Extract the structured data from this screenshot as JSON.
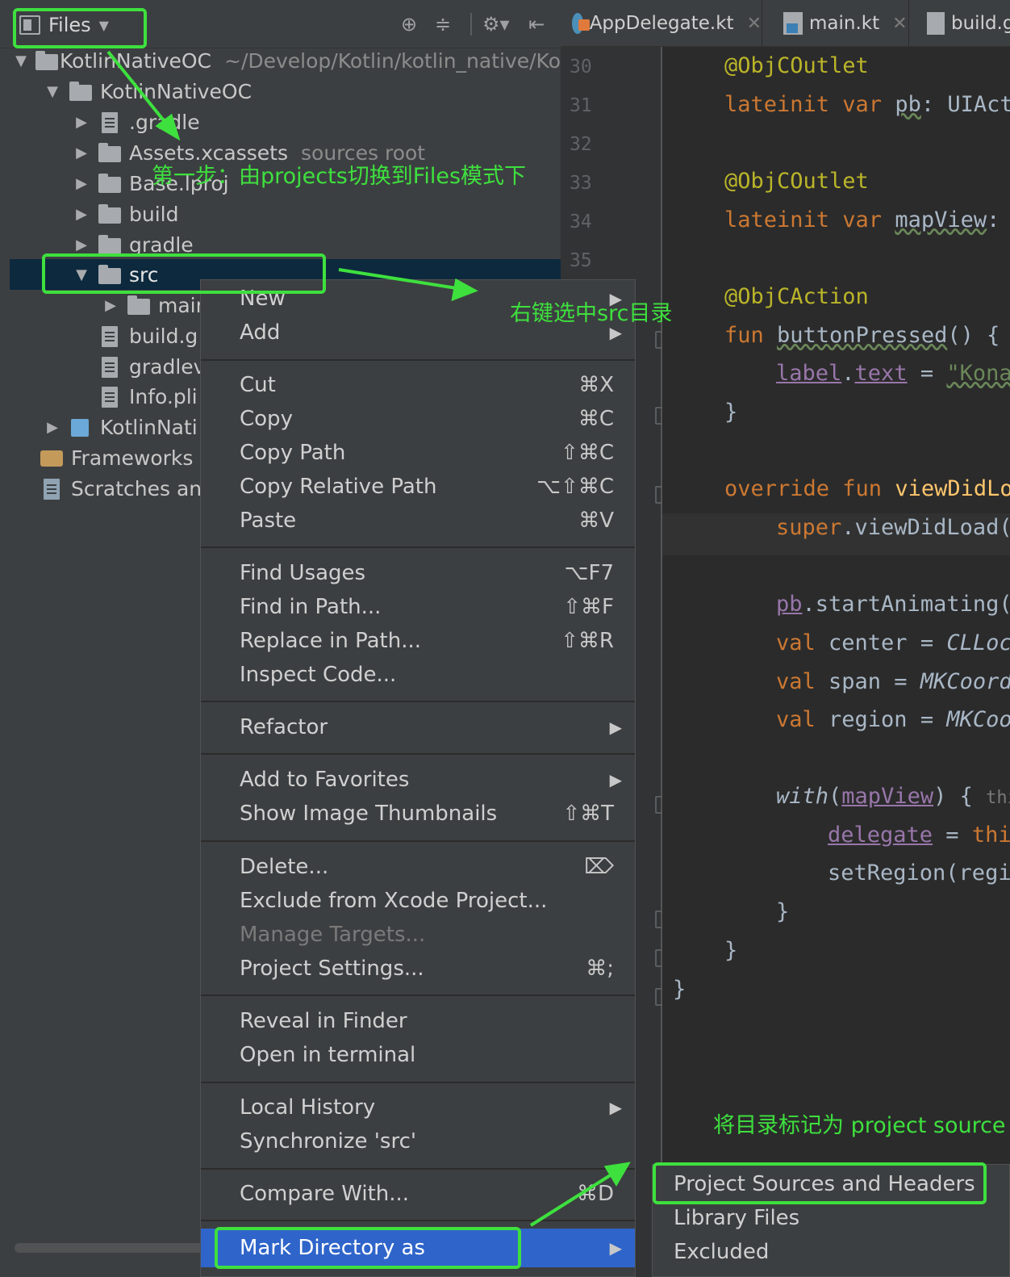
{
  "toolbar": {
    "view_label": "Files",
    "icons": [
      "locate-icon",
      "collapse-icon",
      "gear-icon",
      "hide-icon"
    ]
  },
  "tree": {
    "items": [
      {
        "label": "KotlinNativeOC",
        "hint": "~/Develop/Kotlin/kotlin_native/Ko"
      },
      {
        "label": "KotlinNativeOC"
      },
      {
        "label": ".gradle"
      },
      {
        "label": "Assets.xcassets",
        "hint": "sources root"
      },
      {
        "label": "Base.lproj"
      },
      {
        "label": "build"
      },
      {
        "label": "gradle"
      },
      {
        "label": "src"
      },
      {
        "label": "main"
      },
      {
        "label": "build.g"
      },
      {
        "label": "gradlev"
      },
      {
        "label": "Info.pli"
      },
      {
        "label": "KotlinNati"
      },
      {
        "label": "Frameworks"
      },
      {
        "label": "Scratches an"
      }
    ]
  },
  "editor": {
    "tabs": [
      {
        "label": "AppDelegate.kt"
      },
      {
        "label": "main.kt"
      },
      {
        "label": "build.g"
      }
    ],
    "line_numbers": [
      "30",
      "31",
      "32",
      "33",
      "34",
      "35"
    ],
    "code": {
      "l1": "@ObjCOutlet",
      "l2_kw": "lateinit var ",
      "l2_name": "pb",
      "l2_rest": ": UIAct",
      "l3": "@ObjCOutlet",
      "l4_kw": "lateinit var ",
      "l4_name": "mapView",
      "l4_rest": ": I",
      "l5": "@ObjCAction",
      "l6_kw": "fun ",
      "l6_name": "buttonPressed",
      "l6_rest": "() {",
      "l7_a": "label",
      "l7_b": ".",
      "l7_c": "text",
      "l7_d": " = ",
      "l7_e": "\"Kona",
      "l8": "}",
      "l9_kw": "override fun ",
      "l9_name": "viewDidLo",
      "l10_kw": "super",
      "l10_rest": ".viewDidLoad(",
      "l11_a": "pb",
      "l11_b": ".startAnimating(",
      "l12_kw": "val ",
      "l12_rest": "center = ",
      "l12_it": "CLLoc",
      "l13_kw": "val ",
      "l13_rest": "span = ",
      "l13_it": "MKCoord",
      "l14_kw": "val ",
      "l14_rest": "region = ",
      "l14_it": "MKCoo",
      "l15_it": "with",
      "l15_a": "(",
      "l15_b": "mapView",
      "l15_c": ") { ",
      "l15_hint": "this",
      "l16_a": "delegate",
      "l16_b": " = ",
      "l16_c": "thi",
      "l17": "setRegion(regi",
      "l18": "}",
      "l19": "}",
      "l20": "}"
    }
  },
  "context_menu": {
    "items": [
      {
        "label": "New",
        "submenu": true
      },
      {
        "label": "Add",
        "submenu": true
      },
      {
        "label": "Cut",
        "shortcut": "⌘X"
      },
      {
        "label": "Copy",
        "shortcut": "⌘C"
      },
      {
        "label": "Copy Path",
        "shortcut": "⇧⌘C"
      },
      {
        "label": "Copy Relative Path",
        "shortcut": "⌥⇧⌘C"
      },
      {
        "label": "Paste",
        "shortcut": "⌘V"
      },
      {
        "label": "Find Usages",
        "shortcut": "⌥F7"
      },
      {
        "label": "Find in Path...",
        "shortcut": "⇧⌘F"
      },
      {
        "label": "Replace in Path...",
        "shortcut": "⇧⌘R"
      },
      {
        "label": "Inspect Code..."
      },
      {
        "label": "Refactor",
        "submenu": true
      },
      {
        "label": "Add to Favorites",
        "submenu": true
      },
      {
        "label": "Show Image Thumbnails",
        "shortcut": "⇧⌘T"
      },
      {
        "label": "Delete...",
        "shortcut": "⌦"
      },
      {
        "label": "Exclude from Xcode Project..."
      },
      {
        "label": "Manage Targets...",
        "disabled": true
      },
      {
        "label": "Project Settings...",
        "shortcut": "⌘;"
      },
      {
        "label": "Reveal in Finder"
      },
      {
        "label": "Open in terminal"
      },
      {
        "label": "Local History",
        "submenu": true
      },
      {
        "label": "Synchronize 'src'"
      },
      {
        "label": "Compare With...",
        "shortcut": "⌘D"
      },
      {
        "label": "Mark Directory as",
        "submenu": true,
        "highlighted": true
      }
    ],
    "submenu_arrow": "▶"
  },
  "submenu": {
    "items": [
      {
        "label": "Project Sources and Headers"
      },
      {
        "label": "Library Files"
      },
      {
        "label": "Excluded"
      }
    ]
  },
  "annotations": {
    "step1": "第一步：由projects切换到Files模式下",
    "step2": "右键选中src目录",
    "step3": "将目录标记为 project source",
    "color": "#3ee03e"
  },
  "colors": {
    "panel_bg": "#3c3f41",
    "editor_bg": "#2b2b2b",
    "selection": "#2f65ca",
    "tree_selection": "#0d293e",
    "keyword": "#cc7832",
    "annotation": "#bbb529",
    "function": "#ffc66d",
    "field": "#9876aa"
  }
}
